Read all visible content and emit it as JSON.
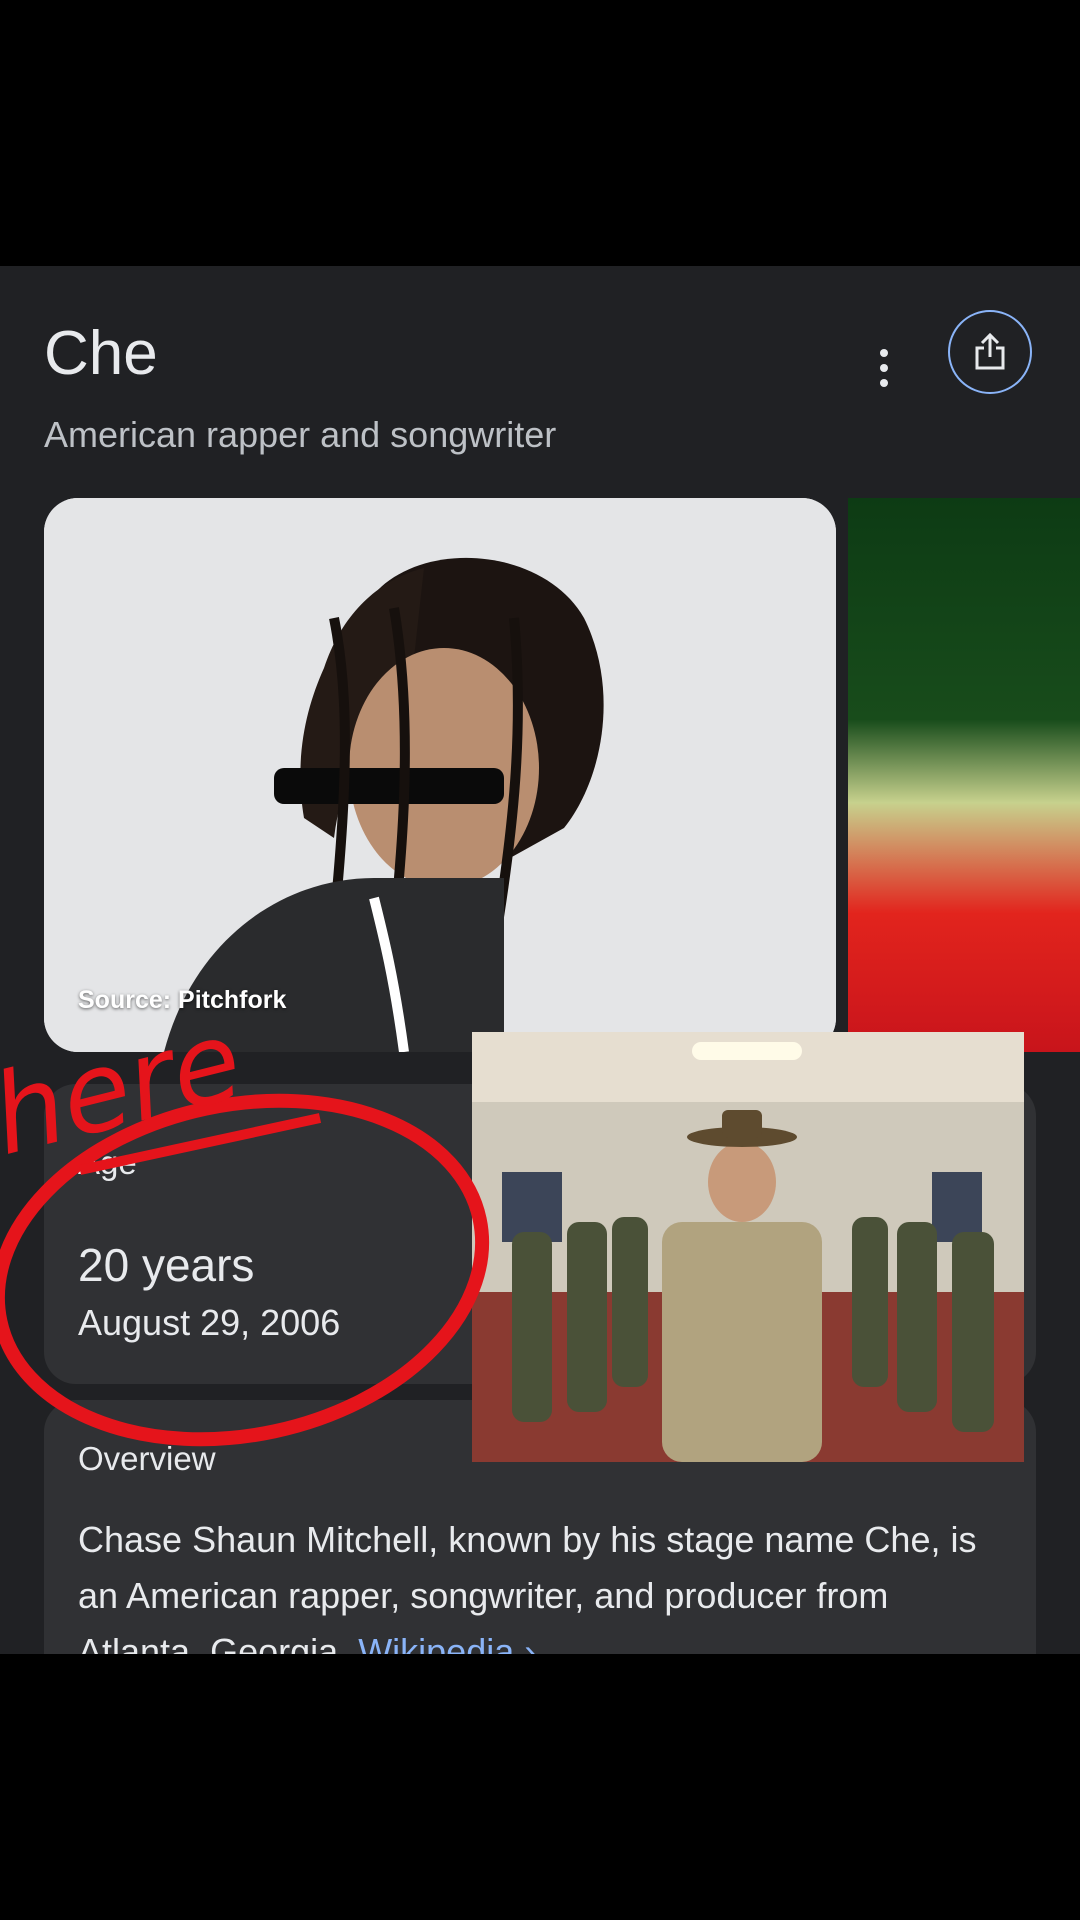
{
  "header": {
    "title": "Che",
    "subtitle": "American rapper and songwriter"
  },
  "actions": {
    "more_icon": "more-vert-icon",
    "share_icon": "share-icon"
  },
  "image": {
    "source": "Source: Pitchfork"
  },
  "age": {
    "label": "Age",
    "value": "20 years",
    "date": "August 29, 2006"
  },
  "overview": {
    "label": "Overview",
    "text": "Chase Shaun Mitchell, known by his stage name Che, is an American rapper, songwriter, and producer from Atlanta, Georgia.",
    "link": "Wikipedia ›"
  },
  "annotation": {
    "text": "here",
    "color": "#e5141b"
  },
  "colors": {
    "background": "#202124",
    "card": "#303134",
    "link": "#8ab4f8"
  }
}
